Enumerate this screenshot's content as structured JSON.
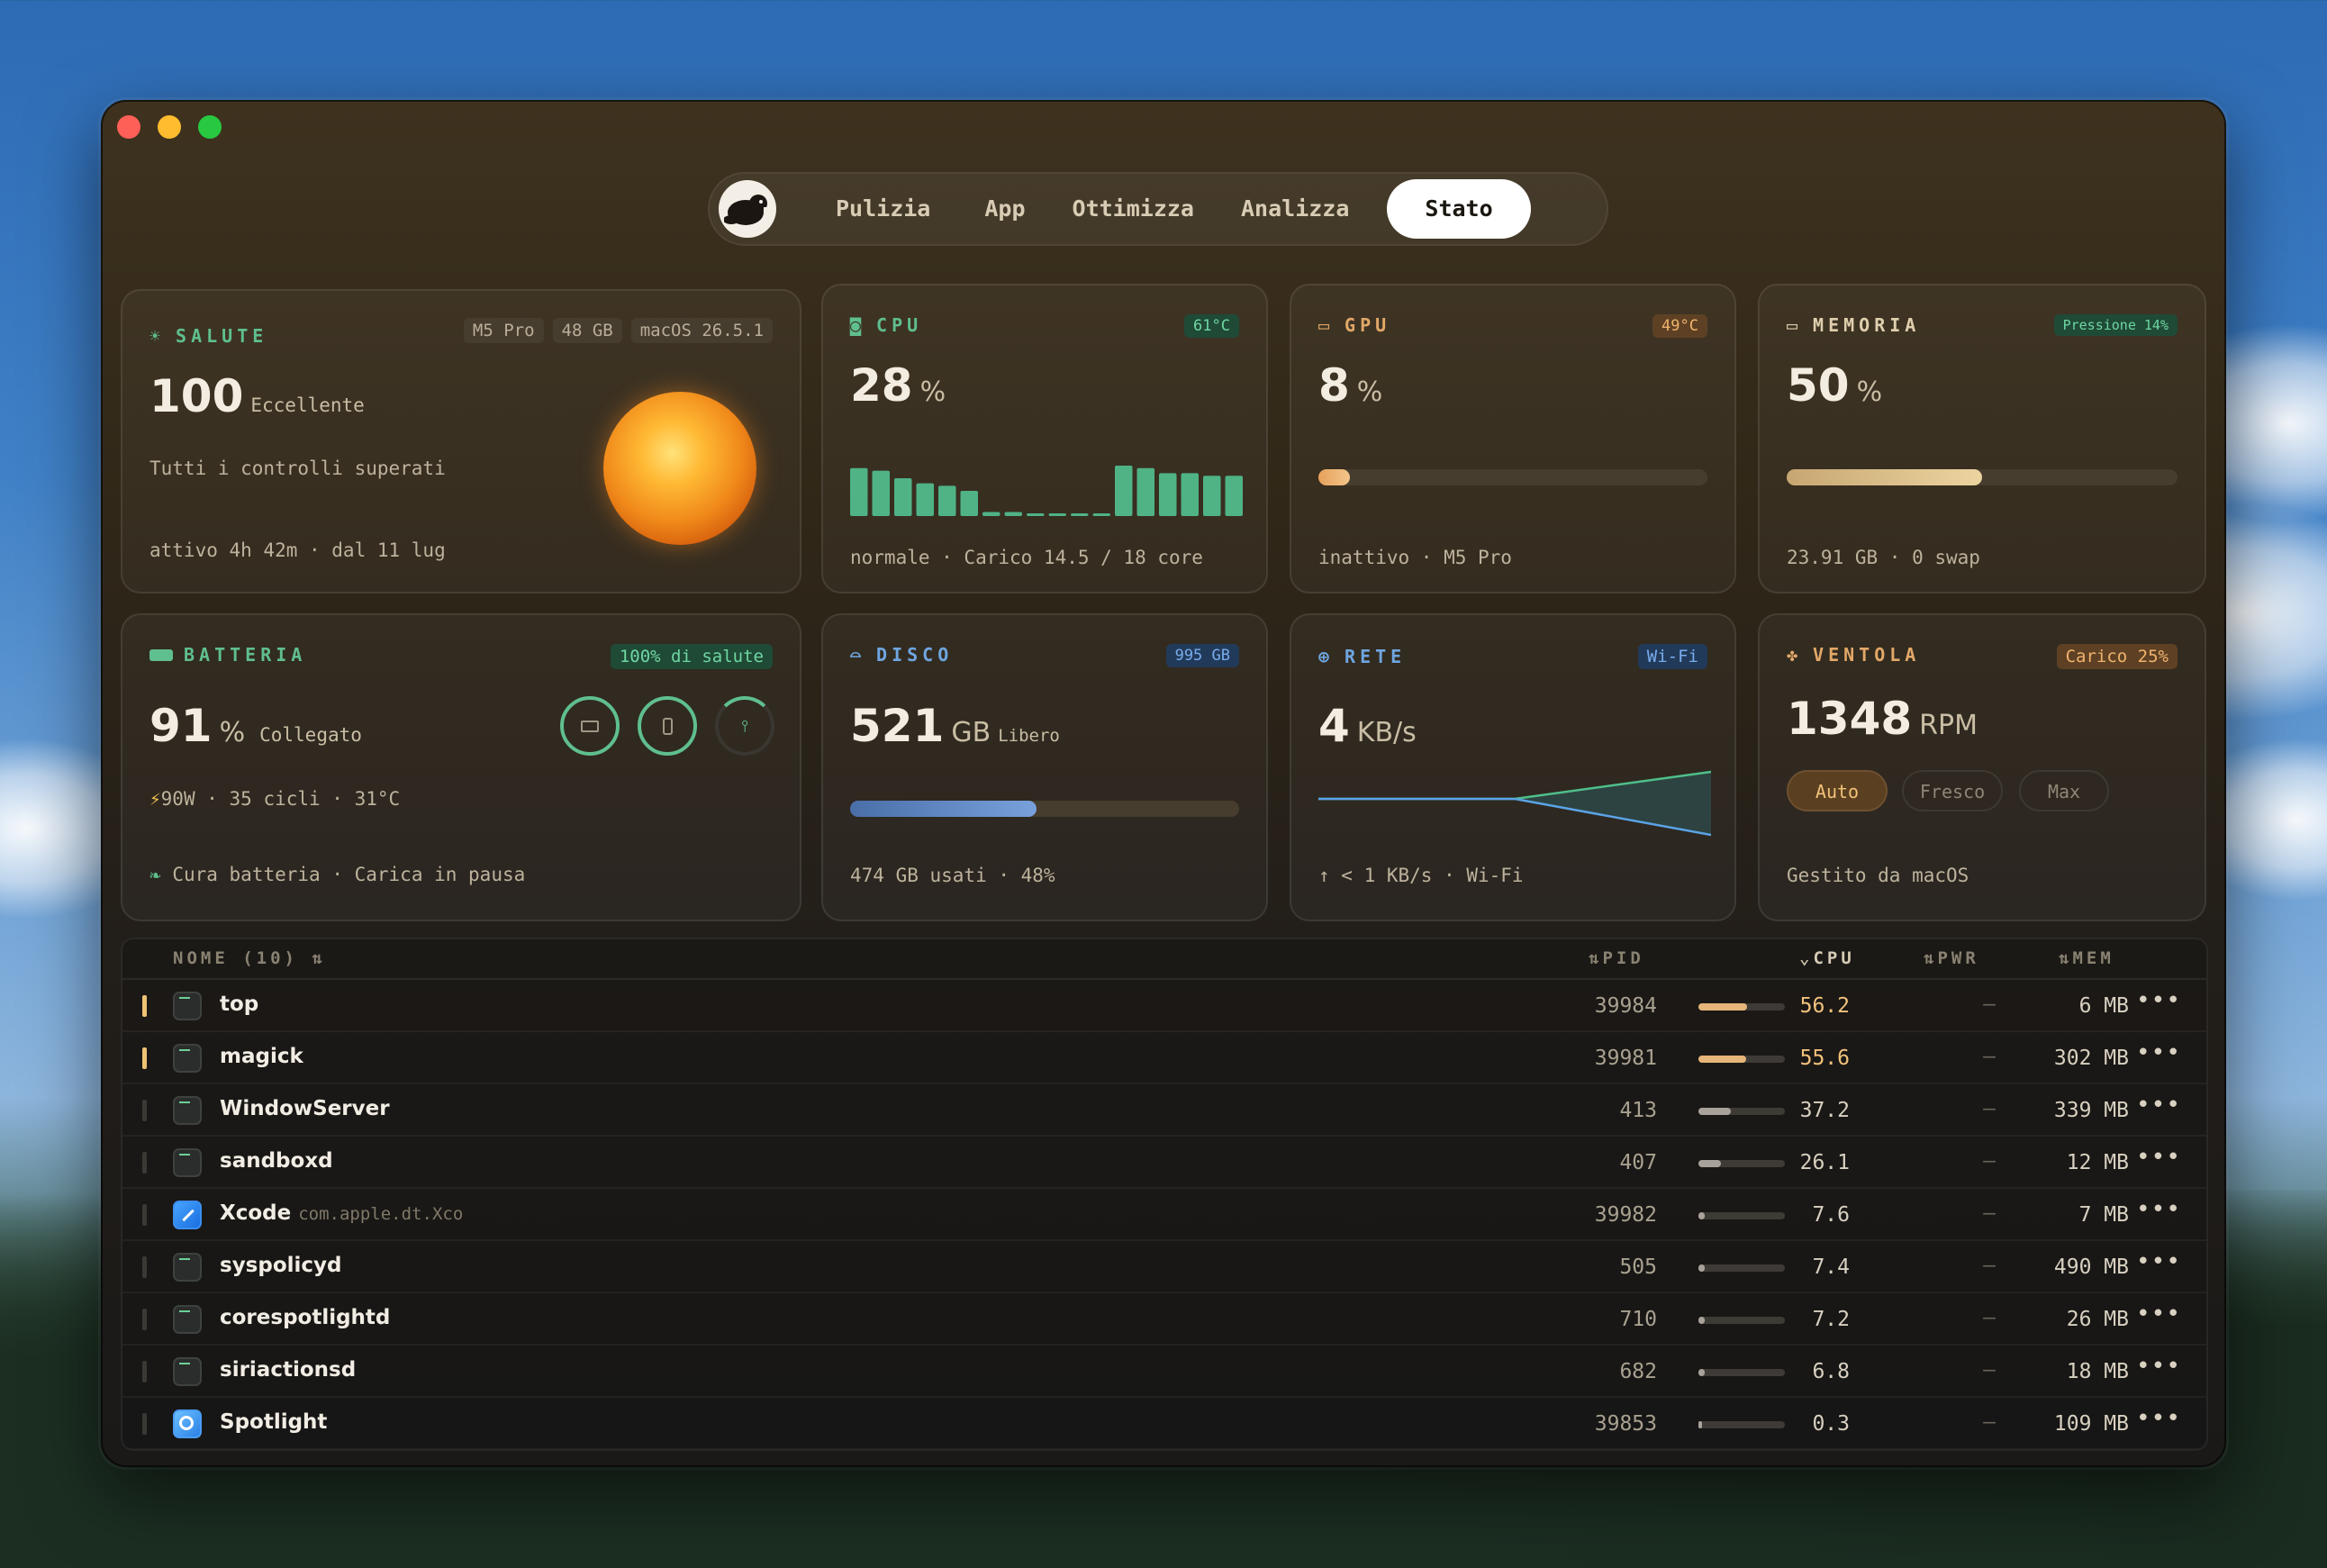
{
  "nav": {
    "tabs": [
      "Pulizia",
      "App",
      "Ottimizza",
      "Analizza",
      "Stato"
    ],
    "active": "Stato"
  },
  "health": {
    "title": "SALUTE",
    "chips": [
      "M5 Pro",
      "48 GB",
      "macOS 26.5.1"
    ],
    "score": "100",
    "rating": "Eccellente",
    "message": "Tutti i controlli superati",
    "uptime": "attivo 4h 42m · dal 11 lug"
  },
  "cpu": {
    "title": "CPU",
    "temp": "61°C",
    "value": "28",
    "unit": "%",
    "footer": "normale · Carico 14.5 / 18 core",
    "cores": [
      0.95,
      0.9,
      0.75,
      0.65,
      0.6,
      0.5,
      0.08,
      0.08,
      0.05,
      0.05,
      0.05,
      0.05,
      1.0,
      0.95,
      0.85,
      0.85,
      0.8,
      0.8
    ]
  },
  "gpu": {
    "title": "GPU",
    "temp": "49°C",
    "value": "8",
    "unit": "%",
    "usage": 0.08,
    "footer": "inattivo · M5 Pro"
  },
  "memory": {
    "title": "MEMORIA",
    "badge": "Pressione 14%",
    "value": "50",
    "unit": "%",
    "usage": 0.5,
    "footer": "23.91 GB · 0 swap"
  },
  "battery": {
    "title": "BATTERIA",
    "badge": "100% di salute",
    "value": "91",
    "unit": "%",
    "status": "Collegato",
    "power": "90W · 35 cicli · 31°C",
    "care": "Cura batteria · Carica in pausa"
  },
  "disk": {
    "title": "DISCO",
    "badge": "995 GB",
    "value": "521",
    "unit": "GB",
    "status": "Libero",
    "usage": 0.48,
    "footer": "474 GB usati · 48%"
  },
  "network": {
    "title": "RETE",
    "badge": "Wi-Fi",
    "value": "4",
    "unit": "KB/s",
    "footer": "↑ < 1 KB/s · Wi-Fi"
  },
  "fan": {
    "title": "VENTOLA",
    "badge": "Carico 25%",
    "value": "1348",
    "unit": "RPM",
    "modes": [
      "Auto",
      "Fresco",
      "Max"
    ],
    "active_mode": "Auto",
    "footer": "Gestito da macOS"
  },
  "table": {
    "headers": {
      "name": "NOME (10)",
      "pid": "PID",
      "cpu": "CPU",
      "pwr": "PWR",
      "mem": "MEM"
    },
    "rows": [
      {
        "name": "top",
        "sub": "",
        "pid": "39984",
        "cpu": "56.2",
        "pwr": "—",
        "mem": "6 MB",
        "load": 0.562,
        "hot": true,
        "icon": "terminal"
      },
      {
        "name": "magick",
        "sub": "",
        "pid": "39981",
        "cpu": "55.6",
        "pwr": "—",
        "mem": "302 MB",
        "load": 0.556,
        "hot": true,
        "icon": "terminal"
      },
      {
        "name": "WindowServer",
        "sub": "",
        "pid": "413",
        "cpu": "37.2",
        "pwr": "—",
        "mem": "339 MB",
        "load": 0.372,
        "hot": false,
        "icon": "terminal"
      },
      {
        "name": "sandboxd",
        "sub": "",
        "pid": "407",
        "cpu": "26.1",
        "pwr": "—",
        "mem": "12 MB",
        "load": 0.261,
        "hot": false,
        "icon": "terminal"
      },
      {
        "name": "Xcode",
        "sub": "com.apple.dt.Xco",
        "pid": "39982",
        "cpu": "7.6",
        "pwr": "—",
        "mem": "7 MB",
        "load": 0.076,
        "hot": false,
        "icon": "xcode"
      },
      {
        "name": "syspolicyd",
        "sub": "",
        "pid": "505",
        "cpu": "7.4",
        "pwr": "—",
        "mem": "490 MB",
        "load": 0.074,
        "hot": false,
        "icon": "terminal"
      },
      {
        "name": "corespotlightd",
        "sub": "",
        "pid": "710",
        "cpu": "7.2",
        "pwr": "—",
        "mem": "26 MB",
        "load": 0.072,
        "hot": false,
        "icon": "terminal"
      },
      {
        "name": "siriactionsd",
        "sub": "",
        "pid": "682",
        "cpu": "6.8",
        "pwr": "—",
        "mem": "18 MB",
        "load": 0.068,
        "hot": false,
        "icon": "terminal"
      },
      {
        "name": "Spotlight",
        "sub": "",
        "pid": "39853",
        "cpu": "0.3",
        "pwr": "—",
        "mem": "109 MB",
        "load": 0.003,
        "hot": false,
        "icon": "spotlight"
      }
    ]
  },
  "colors": {
    "accent_green": "#5fbf8e",
    "accent_orange": "#e2a868",
    "accent_blue": "#6fa6e0"
  }
}
